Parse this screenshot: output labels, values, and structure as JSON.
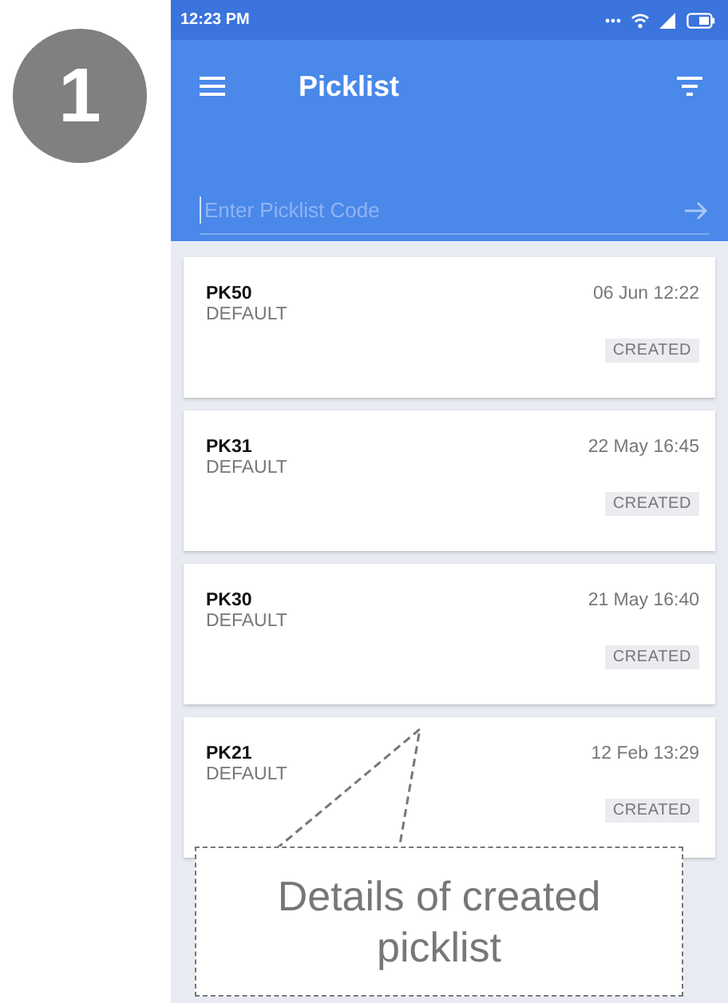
{
  "step_badge": "1",
  "status_bar": {
    "time": "12:23 PM"
  },
  "app_bar": {
    "title": "Picklist"
  },
  "search": {
    "placeholder": "Enter Picklist Code"
  },
  "picklists": [
    {
      "code": "PK50",
      "type": "DEFAULT",
      "date": "06 Jun 12:22",
      "status": "CREATED"
    },
    {
      "code": "PK31",
      "type": "DEFAULT",
      "date": "22 May 16:45",
      "status": "CREATED"
    },
    {
      "code": "PK30",
      "type": "DEFAULT",
      "date": "21 May 16:40",
      "status": "CREATED"
    },
    {
      "code": "PK21",
      "type": "DEFAULT",
      "date": "12 Feb 13:29",
      "status": "CREATED"
    }
  ],
  "callout": {
    "text": "Details of created picklist"
  }
}
